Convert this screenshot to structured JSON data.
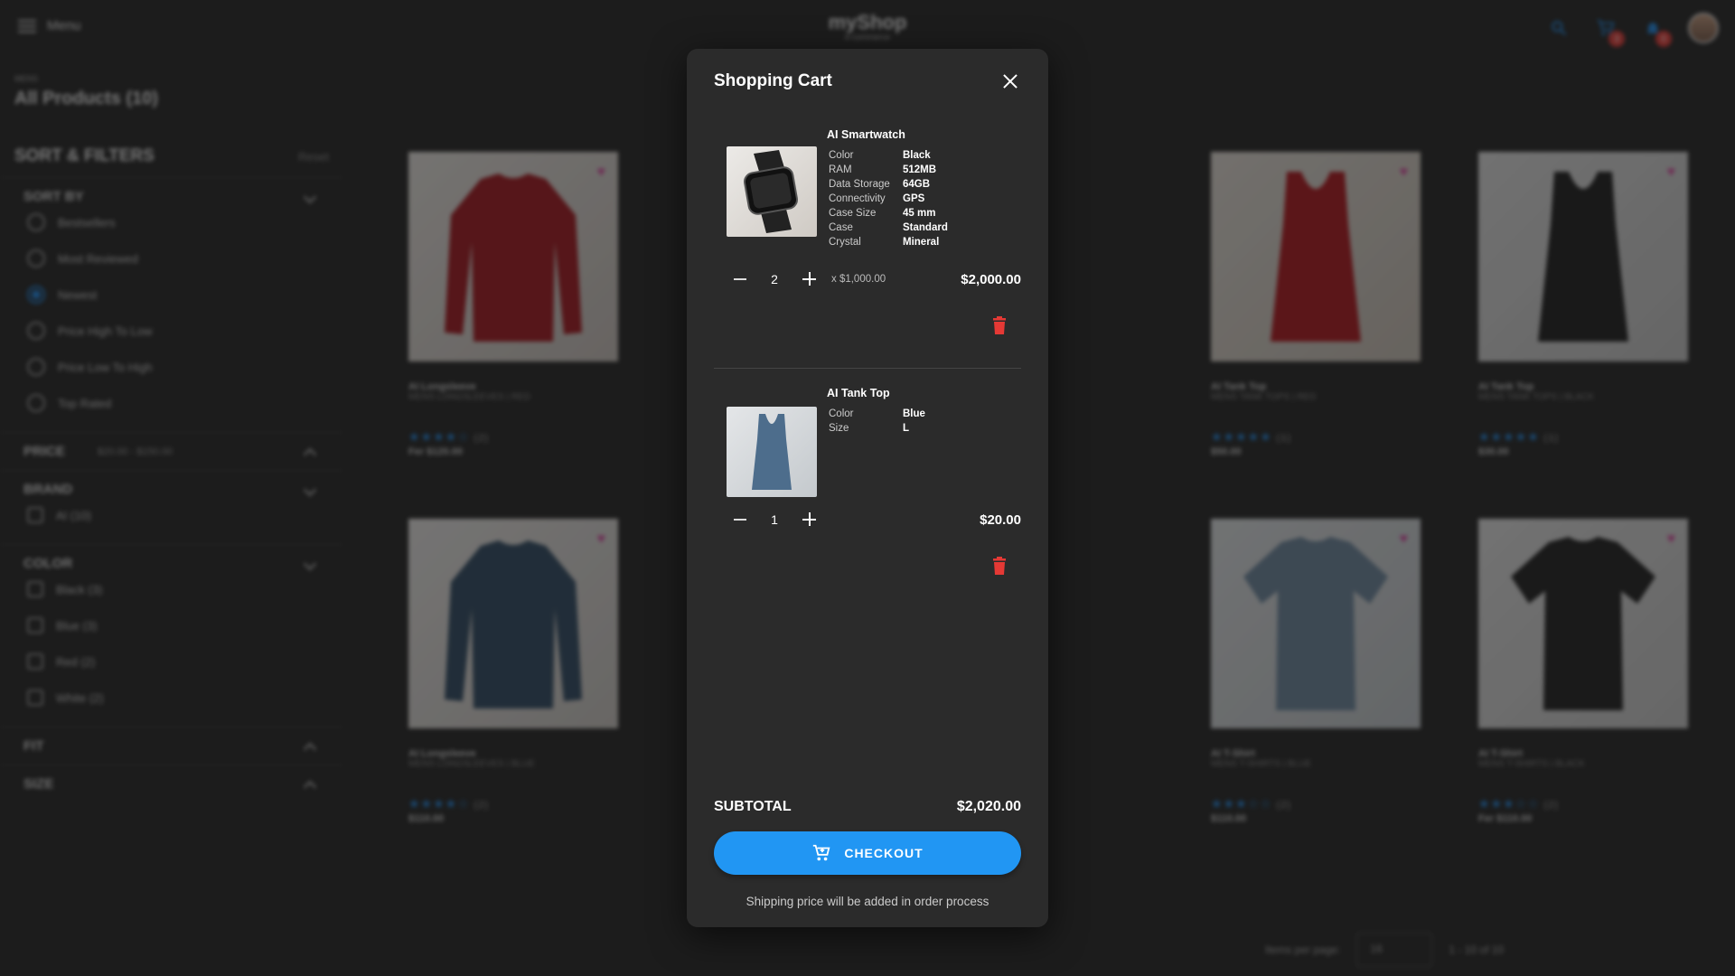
{
  "header": {
    "menu_label": "Menu",
    "brand": "myShop",
    "tagline": "e-commerce",
    "cart_badge": "3",
    "notif_badge": "0"
  },
  "page": {
    "breadcrumb": "MENS",
    "title": "All Products (10)"
  },
  "filters": {
    "title": "SORT & FILTERS",
    "reset": "Reset",
    "sort_title": "SORT BY",
    "sort_options": [
      "Bestsellers",
      "Most Reviewed",
      "Newest",
      "Price High To Low",
      "Price Low To High",
      "Top Rated"
    ],
    "sort_selected": "Newest",
    "price_title": "PRICE",
    "price_range": "$20.00 - $150.00",
    "brand_title": "BRAND",
    "brand_options": [
      "AI (10)"
    ],
    "color_title": "COLOR",
    "color_options": [
      "Black (3)",
      "Blue (3)",
      "Red (2)",
      "White (2)"
    ],
    "fit_title": "FIT",
    "size_title": "SIZE"
  },
  "products": [
    {
      "name": "AI Longsleeve",
      "sub": "MENS LONGSLEEVES | RED",
      "rating": "(2)",
      "price": "Fer $120.00"
    },
    {
      "name": "AI Tank Top",
      "sub": "MENS TANK TOPS | RED",
      "rating": "(1)",
      "price": "$50.00"
    },
    {
      "name": "AI Tank Top",
      "sub": "MENS TANK TOPS | BLACK",
      "rating": "(1)",
      "price": "$30.00"
    },
    {
      "name": "AI Longsleeve",
      "sub": "MENS LONGSLEEVES | BLUE",
      "rating": "(2)",
      "price": "$110.00"
    },
    {
      "name": "AI T-Shirt",
      "sub": "MENS T-SHIRTS | BLUE",
      "rating": "(2)",
      "price": "$110.00"
    },
    {
      "name": "AI T-Shirt",
      "sub": "MENS T-SHIRTS | BLACK",
      "rating": "(2)",
      "price": "Fer $110.00"
    }
  ],
  "pagination": {
    "items_per_page_label": "Items per page:",
    "items_per_page": "16",
    "range": "1 - 10 of 10"
  },
  "cart": {
    "title": "Shopping Cart",
    "items": [
      {
        "name": "AI Smartwatch",
        "specs": [
          {
            "k": "Color",
            "v": "Black"
          },
          {
            "k": "RAM",
            "v": "512MB"
          },
          {
            "k": "Data Storage",
            "v": "64GB"
          },
          {
            "k": "Connectivity",
            "v": "GPS"
          },
          {
            "k": "Case Size",
            "v": "45 mm"
          },
          {
            "k": "Case",
            "v": "Standard"
          },
          {
            "k": "Crystal",
            "v": "Mineral"
          }
        ],
        "qty": "2",
        "unit_price": "x $1,000.00",
        "total": "$2,000.00"
      },
      {
        "name": "AI Tank Top",
        "specs": [
          {
            "k": "Color",
            "v": "Blue"
          },
          {
            "k": "Size",
            "v": "L"
          }
        ],
        "qty": "1",
        "unit_price": "",
        "total": "$20.00"
      }
    ],
    "subtotal_label": "SUBTOTAL",
    "subtotal": "$2,020.00",
    "checkout_label": "CHECKOUT",
    "shipping_note": "Shipping price will be added in order process"
  },
  "colors": {
    "accent": "#2196f3",
    "danger": "#e53935",
    "dialog_bg": "#2b2b2b",
    "page_bg": "#232323"
  }
}
